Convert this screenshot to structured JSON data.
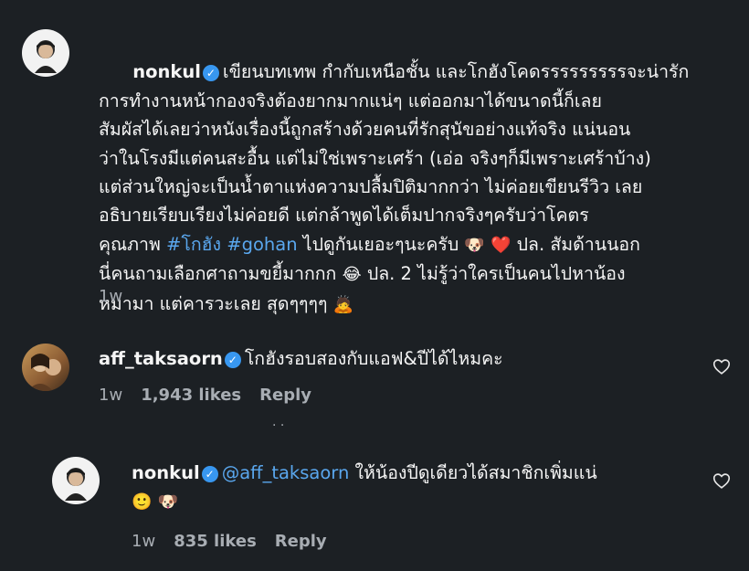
{
  "comments": [
    {
      "username": "nonkul",
      "text_lines": [
        "เขียนบทเทพ กำกับเหนือชั้น และโกฮังโคดรรรรรรรรรจะน่ารัก",
        "การทำงานหน้ากองจริงต้องยากมากแน่ๆ แต่ออกมาได้ขนาดนี้ก็เลย",
        "สัมผัสได้เลยว่าหนังเรื่องนี้ถูกสร้างด้วยคนที่รักสุนัขอย่างแท้จริง แน่นอน",
        "ว่าในโรงมีแต่คนสะอื้น แต่ไม่ใช่เพราะเศร้า (เอ่อ จริงๆก็มีเพราะเศร้าบ้าง)",
        "แต่ส่วนใหญ่จะเป็นน้ำตาแห่งความปลื้มปิติมากกว่า ไม่ค่อยเขียนรีวิว เลย",
        "อธิบายเรียบเรียงไม่ค่อยดี แต่กล้าพูดได้เต็มปากจริงๆครับว่าโคตร"
      ],
      "line7_prefix": "คุณภาพ ",
      "hashtag1": "#โกฮัง",
      "hashtag2": "#gohan",
      "line7_suffix": " ไปดูกันเยอะๆนะครับ ",
      "line7_emoji1": "🐶",
      "line7_emoji2": "❤️",
      "line7_end": " ปล. สัมด้านนอก",
      "line8_start": "นี่คนถามเลือกศาถามขยี้มากกก ",
      "line8_emoji": "😂",
      "line8_end": " ปล. 2 ไม่รู้ว่าใครเป็นคนไปหาน้อง",
      "line9_text": "หมามา แต่คารวะเลย สุดๆๆๆๆ ",
      "line9_emoji": "🙇",
      "time": "1w"
    },
    {
      "username": "aff_taksaorn",
      "text": "โกฮังรอบสองกับแอฟ&ปีได้ไหมคะ",
      "time": "1w",
      "likes": "1,943 likes",
      "reply": "Reply"
    },
    {
      "username": "nonkul",
      "mention": "@aff_taksaorn",
      "text": " ให้น้องปีดูเดียวได้สมาชิกเพิ่มแน่",
      "emoji1": "🙂",
      "emoji2": "🐶",
      "time": "1w",
      "likes": "835 likes",
      "reply": "Reply"
    }
  ],
  "icons": {
    "verified": "verified-badge-icon",
    "heart": "heart-outline-icon"
  },
  "colors": {
    "background": "#1c2024",
    "link": "#5aa7ee",
    "verified": "#3897f0",
    "muted": "#a8adb3"
  }
}
